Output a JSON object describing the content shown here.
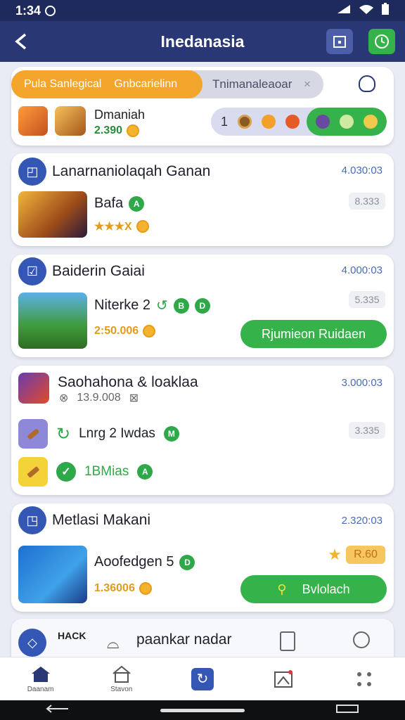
{
  "status": {
    "time": "1:34"
  },
  "app_bar": {
    "title": "Inedanasia"
  },
  "filters": {
    "active_tab_a": "Pula Sanlegical",
    "active_tab_b": "Gnbcarielinn",
    "inactive_tab": "Tnimanaleaoar",
    "close_symbol": "×"
  },
  "featured": {
    "name": "Dmaniah",
    "price": "2.390",
    "pill_count": "1"
  },
  "cards": [
    {
      "title": "Lanarnaniolaqah Ganan",
      "date": "4.030:03",
      "game": "Bafa",
      "score": "8.333",
      "price": "★★★X"
    },
    {
      "title": "Baiderin Gaiai",
      "date": "4.000:03",
      "game": "Niterke 2",
      "score": "5.335",
      "price": "2:50.006",
      "cta": "Rjumieon Ruidaen"
    },
    {
      "title": "Saohahona & loaklaa",
      "date": "3.000:03",
      "sub_price": "13.9.008",
      "row2": "Lnrg 2 Iwdas",
      "row3": "1BMias",
      "score": "3.335"
    },
    {
      "title": "Metlasi Makani",
      "date": "2.320:03",
      "game": "Aoofedgen 5",
      "score": "R.60",
      "price": "1.36006",
      "cta": "Bvlolach"
    }
  ],
  "partial": {
    "title": "paankar nadar",
    "thumb_text": "HACK"
  },
  "nav": {
    "home": "Daanam",
    "store": "Stavon"
  },
  "colors": {
    "primary": "#2a3775",
    "accent_green": "#36b24a",
    "accent_orange": "#f4a52c"
  }
}
